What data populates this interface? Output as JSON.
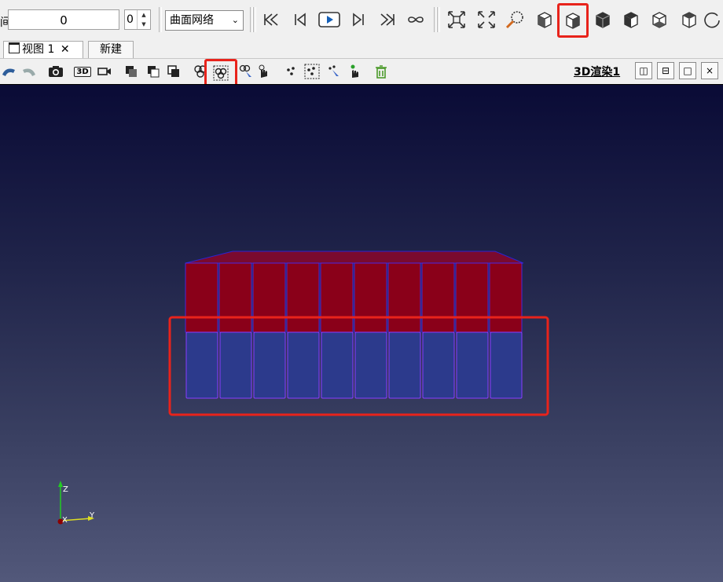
{
  "toolbar": {
    "time_label": "间:",
    "time_value": "0",
    "time_index": "0",
    "representation": "曲面网络",
    "icons": [
      "first-frame-icon",
      "prev-frame-icon",
      "play-icon",
      "next-frame-icon",
      "last-frame-icon",
      "loop-icon",
      "reset-camera-icon",
      "zoom-to-data-icon",
      "zoom-to-box-icon",
      "view-neg-x-icon",
      "view-pos-x-icon",
      "view-neg-y-icon",
      "view-pos-y-icon",
      "view-neg-z-icon",
      "view-pos-z-icon",
      "rotate-90-icon"
    ]
  },
  "tabs": {
    "view1": "视图 1",
    "close_glyph": "✕",
    "new": "新建"
  },
  "view_toolbar": {
    "render_view_label": "3D渲染1",
    "label_3d": "3D",
    "split_h_glyph": "◫",
    "split_v_glyph": "⊟",
    "maximize_glyph": "□",
    "close_glyph": "×"
  },
  "axes": {
    "z": "Z",
    "y": "Y",
    "x": "X"
  },
  "colors": {
    "highlight": "#e8231b",
    "top_block": "#8a0019",
    "bottom_block": "#2c3a8c",
    "edge": "#4a2cff",
    "bg_top": "#0a0b36",
    "bg_bottom": "#52587a"
  }
}
